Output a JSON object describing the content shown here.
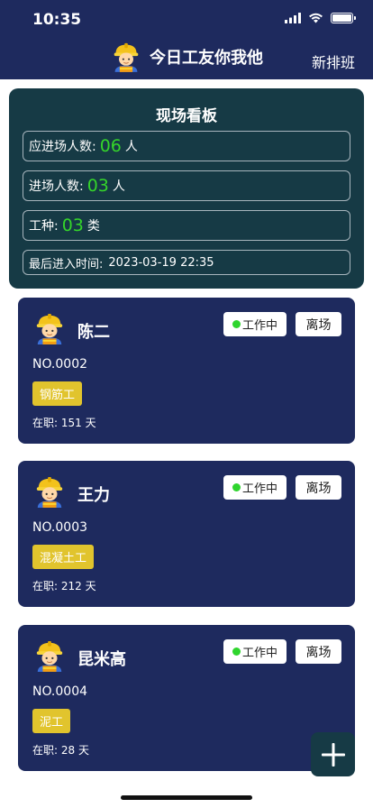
{
  "status_bar": {
    "time": "10:35"
  },
  "header": {
    "title": "今日工友你我他",
    "schedule_label": "新排班",
    "avatar_icon": "construction-worker-icon"
  },
  "board": {
    "title": "现场看板",
    "expected_label": "应进场人数:",
    "expected_value": "06",
    "expected_unit": "人",
    "entered_label": "进场人数:",
    "entered_value": "03",
    "entered_unit": "人",
    "trades_label": "工种:",
    "trades_value": "03",
    "trades_unit": "类",
    "last_entry_label": "最后进入时间:",
    "last_entry_value": "2023-03-19 22:35"
  },
  "workers": [
    {
      "name": "陈二",
      "number": "NO.0002",
      "trade": "钢筋工",
      "status": "工作中",
      "leave_label": "离场",
      "tenure_label": "在职:",
      "tenure_value": "151 天"
    },
    {
      "name": "王力",
      "number": "NO.0003",
      "trade": "混凝土工",
      "status": "工作中",
      "leave_label": "离场",
      "tenure_label": "在职:",
      "tenure_value": "212 天"
    },
    {
      "name": "昆米高",
      "number": "NO.0004",
      "trade": "泥工",
      "status": "工作中",
      "leave_label": "离场",
      "tenure_label": "在职:",
      "tenure_value": "28 天"
    }
  ],
  "colors": {
    "primary": "#1e2a5e",
    "board_bg": "#163a45",
    "highlight": "#35d52a",
    "tag": "#e1c42d",
    "status_dot": "#2fd52e"
  }
}
